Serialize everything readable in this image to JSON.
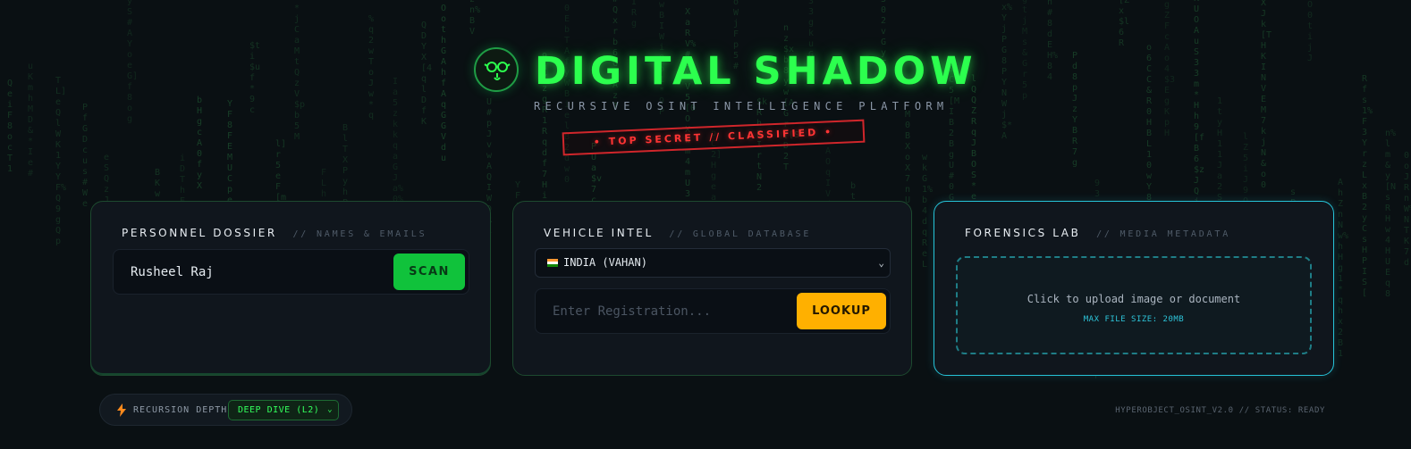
{
  "header": {
    "title": "DIGITAL SHADOW",
    "subtitle": "RECURSIVE OSINT INTELLIGENCE PLATFORM",
    "stamp": "• TOP SECRET // CLASSIFIED •",
    "logo_icon": "spy-glasses-icon"
  },
  "cards": {
    "personnel": {
      "title": "PERSONNEL DOSSIER",
      "subtitle": "// NAMES & EMAILS",
      "input_value": "Rusheel Raj",
      "button_label": "SCAN"
    },
    "vehicle": {
      "title": "VEHICLE INTEL",
      "subtitle": "// GLOBAL DATABASE",
      "country_selected": "INDIA (VAHAN)",
      "country_flag": "india-flag-icon",
      "input_placeholder": "Enter Registration...",
      "button_label": "LOOKUP"
    },
    "forensics": {
      "title": "FORENSICS LAB",
      "subtitle": "// MEDIA METADATA",
      "dropzone_text": "Click to upload image or document",
      "dropzone_hint": "MAX FILE SIZE: 20MB"
    }
  },
  "footer": {
    "depth_label": "RECURSION DEPTH:",
    "depth_value": "DEEP DIVE (L2)",
    "status": "HYPEROBJECT_OSINT_V2.0 // STATUS: READY"
  },
  "colors": {
    "accent_green": "#2cff4e",
    "scan_button": "#10c23b",
    "lookup_button": "#ffb000",
    "forensics_border": "#26c3d8",
    "stamp_red": "#d0262b",
    "background": "#0a1013"
  }
}
